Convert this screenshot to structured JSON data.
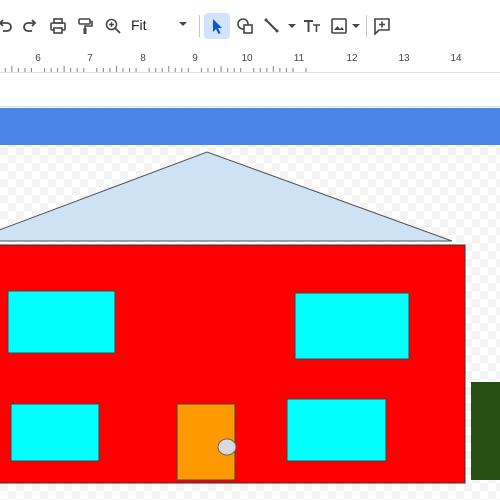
{
  "toolbar": {
    "zoom_value": "Fit",
    "icons": [
      "undo-icon",
      "redo-icon",
      "print-icon",
      "paint-format-icon",
      "zoom-icon",
      "select-icon",
      "shape-icon",
      "line-icon",
      "text-box-icon",
      "image-icon",
      "add-comment-icon"
    ]
  },
  "ruler": {
    "numbers": [
      "6",
      "7",
      "8",
      "9",
      "10",
      "11",
      "12",
      "13",
      "14"
    ]
  },
  "drawing": {
    "colors": {
      "header_bar": "#4a86e8",
      "roof": "#cfe2f3",
      "wall": "#ff0000",
      "window": "#00ffff",
      "door": "#ff9900",
      "knob": "#d9d9d9",
      "green_block": "#274e13"
    }
  }
}
